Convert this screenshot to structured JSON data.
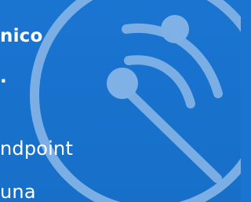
{
  "hero": {
    "title_fragment": "nico",
    "subtitle_fragment": ".",
    "body_lines": [
      "ndpoint",
      "una"
    ]
  },
  "icon": "satellite-signal-icon",
  "colors": {
    "background": "#1b74d0",
    "text": "#ffffff",
    "icon_stroke": "#7fb1e6"
  }
}
